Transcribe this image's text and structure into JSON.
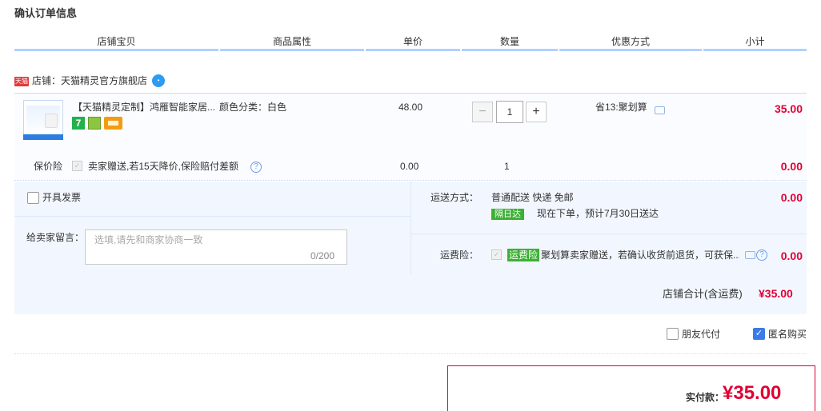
{
  "page_title": "确认订单信息",
  "columns": [
    "店铺宝贝",
    "商品属性",
    "单价",
    "数量",
    "优惠方式",
    "小计"
  ],
  "store": {
    "badge": "天猫",
    "label": "店铺：天猫精灵官方旗舰店"
  },
  "item": {
    "title": "【天猫精灵定制】鸿雁智能家居...",
    "attr": "颜色分类：白色",
    "price": "48.00",
    "quantity": "1",
    "minus": "−",
    "plus": "+",
    "promo": "省13:聚划算",
    "subtotal": "35.00",
    "svc1": "7"
  },
  "protection": {
    "label": "保价险",
    "text": "卖家赠送,若15天降价,保险赔付差额",
    "price": "0.00",
    "qty": "1",
    "subtotal": "0.00"
  },
  "invoice": {
    "label": "开具发票"
  },
  "message": {
    "label": "给卖家留言：",
    "placeholder": "选填,请先和商家协商一致",
    "count": "0/200"
  },
  "shipping": {
    "label": "运送方式：",
    "method": "普通配送 快递 免邮",
    "tag": "隔日达",
    "eta": "现在下单，预计7月30日送达",
    "price": "0.00"
  },
  "freight_insurance": {
    "label": "运费险：",
    "tag": "运费险",
    "text": "聚划算卖家赠送，若确认收货前退货，可获保...",
    "price": "0.00"
  },
  "store_total": {
    "label": "店铺合计(含运费)",
    "amount": "¥35.00"
  },
  "options": {
    "friend_pay": "朋友代付",
    "anonymous": "匿名购买"
  },
  "payment": {
    "label": "实付款：",
    "amount": "¥35.00"
  }
}
